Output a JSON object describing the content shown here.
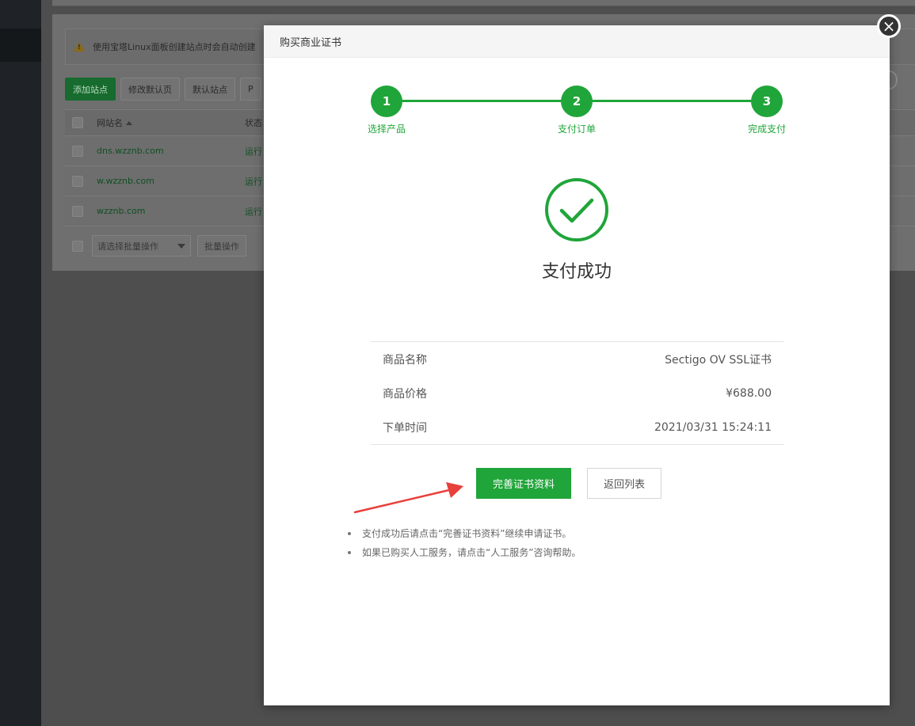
{
  "background": {
    "notice_text": "使用宝塔Linux面板创建站点时会自动创建",
    "toolbar_buttons": [
      "添加站点",
      "修改默认页",
      "默认站点",
      "P"
    ],
    "table_headers": {
      "name": "网站名",
      "status": "状态"
    },
    "rows": [
      {
        "name": "dns.wzznb.com",
        "status": "运行"
      },
      {
        "name": "w.wzznb.com",
        "status": "运行"
      },
      {
        "name": "wzznb.com",
        "status": "运行"
      }
    ],
    "batch_select_placeholder": "请选择批量操作",
    "batch_button": "批量操作"
  },
  "modal": {
    "title": "购买商业证书",
    "close_glyph": "×",
    "steps": [
      {
        "number": "1",
        "label": "选择产品"
      },
      {
        "number": "2",
        "label": "支付订单"
      },
      {
        "number": "3",
        "label": "完成支付"
      }
    ],
    "success_text": "支付成功",
    "info": [
      {
        "label": "商品名称",
        "value": "Sectigo OV SSL证书"
      },
      {
        "label": "商品价格",
        "value": "¥688.00"
      },
      {
        "label": "下单时间",
        "value": "2021/03/31 15:24:11"
      }
    ],
    "primary_button": "完善证书资料",
    "secondary_button": "返回列表",
    "tips": [
      "支付成功后请点击“完善证书资料”继续申请证书。",
      "如果已购买人工服务，请点击“人工服务”咨询帮助。"
    ]
  },
  "colors": {
    "accent_green": "#20a53a",
    "annotation_red": "#e8403b"
  }
}
